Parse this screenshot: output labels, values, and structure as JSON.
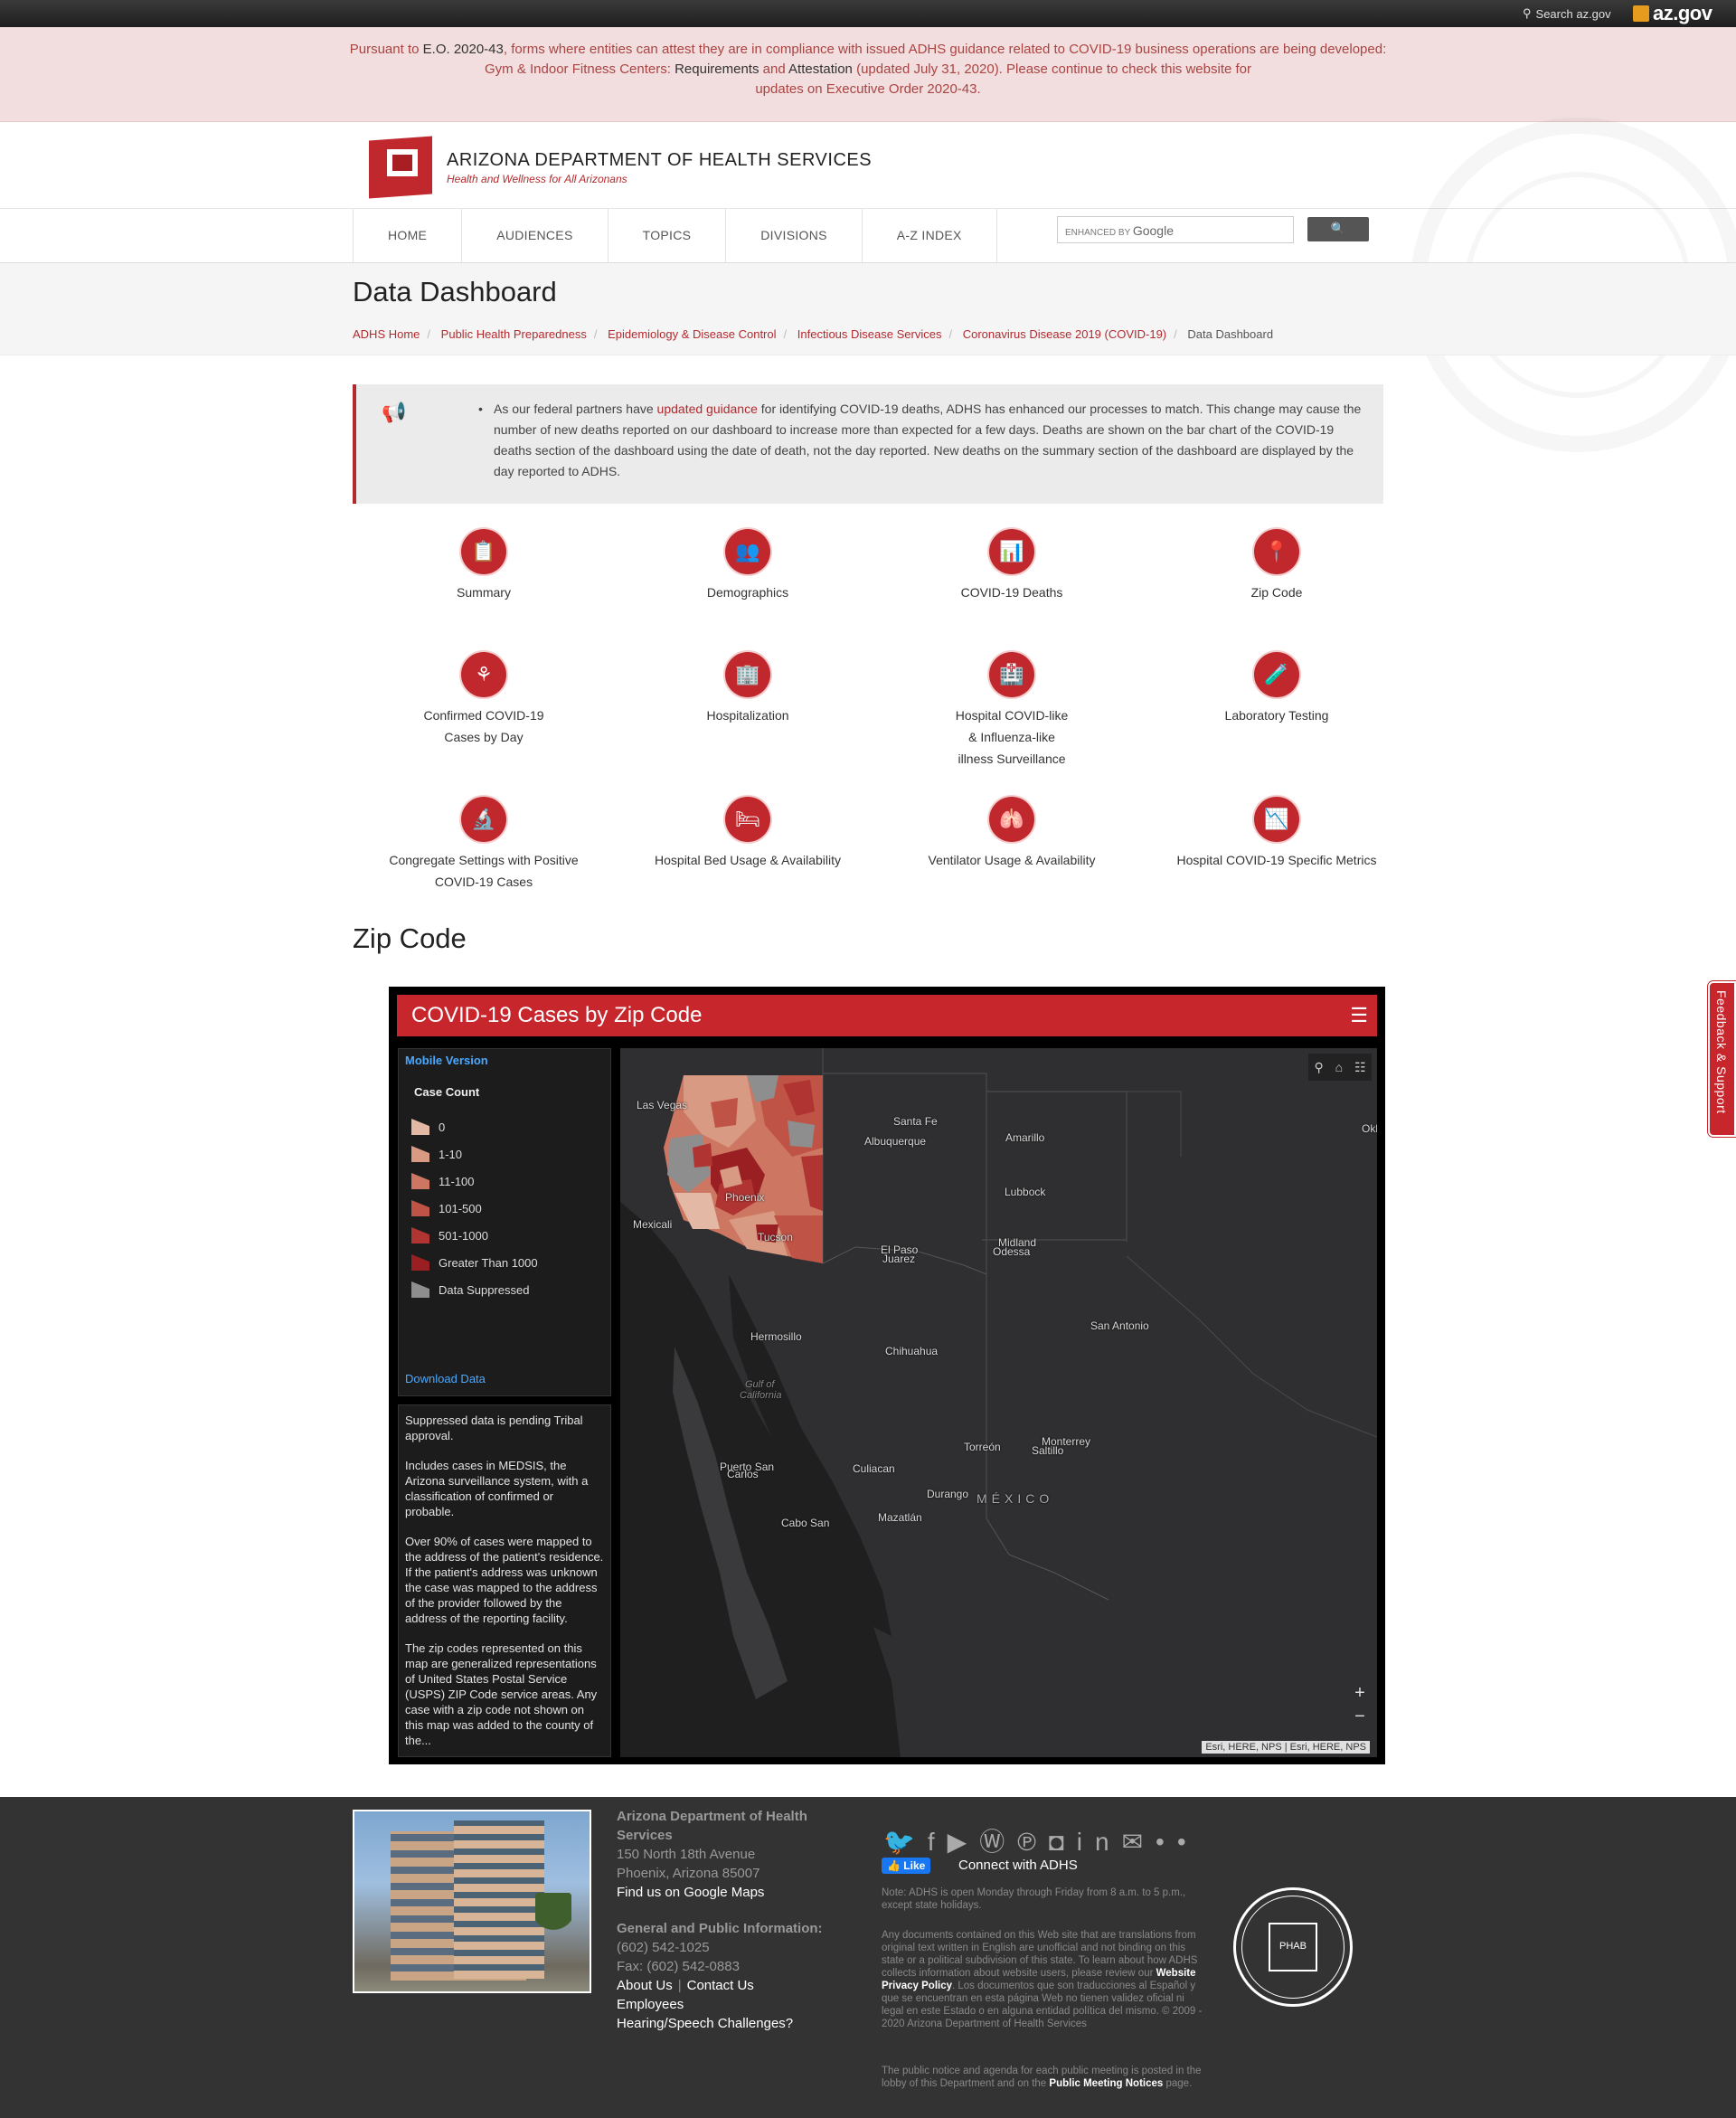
{
  "topbar": {
    "search_label": "Search az.gov",
    "logo": "az.gov"
  },
  "alert": {
    "a1": "Pursuant to ",
    "a2": "E.O. 2020-43",
    "a3": ", forms where entities can attest they are in compliance with issued ADHS guidance related to COVID-19 business operations are being developed:",
    "b1": "Gym & Indoor Fitness Centers: ",
    "b2": "Requirements",
    "b3": " and ",
    "b4": "Attestation",
    "b5": " (updated July 31, 2020). Please continue to check this website for",
    "c1": "updates on Executive Order 2020-43."
  },
  "brand": {
    "title": "ARIZONA DEPARTMENT OF HEALTH SERVICES",
    "tagline": "Health and Wellness for All Arizonans"
  },
  "nav": {
    "items": [
      "HOME",
      "AUDIENCES",
      "TOPICS",
      "DIVISIONS",
      "A-Z INDEX"
    ],
    "search_placeholder": "ENHANCED BY",
    "search_brand": "Google",
    "search_button": "🔍"
  },
  "page": {
    "title": "Data Dashboard",
    "breadcrumbs": [
      "ADHS Home",
      "Public Health Preparedness",
      "Epidemiology & Disease Control",
      "Infectious Disease Services",
      "Coronavirus Disease 2019 (COVID-19)",
      "Data Dashboard"
    ]
  },
  "notice": {
    "t1": "As our federal partners have ",
    "link": "updated guidance",
    "t2": " for identifying COVID-19 deaths, ADHS has enhanced our processes to match. This change may cause the number of new deaths reported on our dashboard to increase more than expected for a few days. Deaths are shown on the bar chart of the COVID-19 deaths section of the dashboard using the date of death, not the day reported. New deaths on the summary section of the dashboard are displayed by the day reported to ADHS."
  },
  "dashboard": {
    "tiles": [
      {
        "label": "Summary",
        "icon": "📋"
      },
      {
        "label": "Demographics",
        "icon": "👥"
      },
      {
        "label": "COVID-19 Deaths",
        "icon": "📊"
      },
      {
        "label": "Zip Code",
        "icon": "📍"
      },
      {
        "label": "Confirmed COVID-19 Cases by Day",
        "icon": "⚘"
      },
      {
        "label": "Hospitalization",
        "icon": "🏢"
      },
      {
        "label": "Hospital COVID-like & Influenza-like illness Surveillance",
        "icon": "🏥"
      },
      {
        "label": "Laboratory Testing",
        "icon": "🧪"
      },
      {
        "label": "Congregate Settings with Positive COVID-19 Cases",
        "icon": "🔬"
      },
      {
        "label": "Hospital Bed Usage & Availability",
        "icon": "🛏"
      },
      {
        "label": "Ventilator Usage & Availability",
        "icon": "🫁"
      },
      {
        "label": "Hospital COVID-19 Specific Metrics",
        "icon": "📉"
      }
    ]
  },
  "zip_section": {
    "heading": "Zip Code"
  },
  "map": {
    "title": "COVID-19 Cases by Zip Code",
    "mobile_link": "Mobile Version",
    "legend_title": "Case Count",
    "legend": [
      {
        "label": "0",
        "color": "#e3b9a6"
      },
      {
        "label": "1-10",
        "color": "#d89a82"
      },
      {
        "label": "11-100",
        "color": "#cd7763"
      },
      {
        "label": "101-500",
        "color": "#bf5346"
      },
      {
        "label": "501-1000",
        "color": "#b03532"
      },
      {
        "label": "Greater Than 1000",
        "color": "#991f22"
      },
      {
        "label": "Data Suppressed",
        "color": "#8e8e8e"
      }
    ],
    "download_link": "Download Data",
    "notes": [
      "Suppressed data is pending Tribal approval.",
      "Includes cases in MEDSIS, the Arizona surveillance system, with a classification of confirmed or probable.",
      "Over 90% of cases were mapped to the address of the patient's residence.  If the patient's address was unknown the case was mapped to the address of the provider followed by the address of the reporting facility.",
      "The zip codes represented on this map are generalized representations of United States Postal Service (USPS) ZIP Code service areas. Any case with a zip code not shown on this map was added to the county of the...",
      ""
    ],
    "places": [
      "Las Vegas",
      "Santa Fe",
      "Albuquerque",
      "Amarillo",
      "Oklahoma",
      "Lubbock",
      "Phoenix",
      "Mexicali",
      "Tucson",
      "El Paso",
      "Juarez",
      "Midland",
      "Odessa",
      "Hermosillo",
      "Chihuahua",
      "San Antonio",
      "Gulf of",
      "California",
      "Monterrey",
      "Saltillo",
      "Torreón",
      "Puerto San",
      "Carlos",
      "Culiacan",
      "Durango",
      "MÉXICO",
      "Cabo San",
      "Mazatlán"
    ],
    "attribution": "Esri, HERE, NPS | Esri, HERE, NPS",
    "zoom_in": "+",
    "zoom_out": "−"
  },
  "feedback": {
    "label": "Feedback & Support"
  },
  "footer": {
    "org": "Arizona Department of Health Services",
    "addr1": "150 North 18th Avenue",
    "addr2": "Phoenix, Arizona 85007",
    "maps": "Find us on Google Maps",
    "gen_title": "General and Public Information:",
    "phone": "(602) 542-1025",
    "fax": "Fax: (602) 542-0883",
    "about": "About Us",
    "contact": "Contact Us",
    "employees": "Employees",
    "hearing": "Hearing/Speech Challenges?",
    "like": "👍 Like",
    "connect": "Connect with ADHS",
    "hours": "Note: ADHS is open Monday through Friday from 8 a.m. to 5 p.m., except state holidays.",
    "disc1": "Any documents contained on this Web site that are translations from original text written in English are unofficial and not binding on this state or a political subdivision of this state. To learn about how ADHS collects information about website users, please review our ",
    "disc_link": "Website Privacy Policy",
    "disc2": ". Los documentos que son traducciones al Español y que se encuentran en esta página Web no tienen validez oficial ni legal en este Estado o en alguna entidad política del mismo. © 2009 - 2020 Arizona Department of Health Services",
    "pub1": "The public notice and agenda for each public meeting is posted in the lobby of this Department and on the ",
    "pub_link": "Public Meeting Notices",
    "pub2": " page.",
    "phab": "PHAB"
  },
  "colors": {
    "brand_red": "#c0282d",
    "alert_bg": "#f2dede",
    "footer_bg": "#333333"
  }
}
